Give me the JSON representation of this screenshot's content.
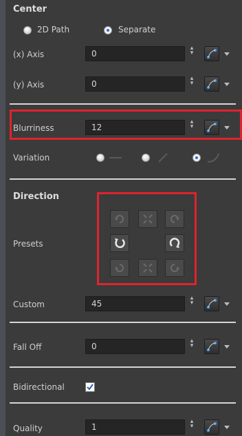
{
  "center": {
    "title": "Center",
    "path_option_1": "2D Path",
    "path_option_2": "Separate",
    "selected": "Separate",
    "x_axis": {
      "label": "(x) Axis",
      "value": "0"
    },
    "y_axis": {
      "label": "(y) Axis",
      "value": "0"
    }
  },
  "blurriness": {
    "label": "Blurriness",
    "value": "12"
  },
  "variation": {
    "label": "Variation",
    "selected_index": 2
  },
  "direction": {
    "title": "Direction",
    "presets_label": "Presets",
    "custom": {
      "label": "Custom",
      "value": "45"
    }
  },
  "fall_off": {
    "label": "Fall Off",
    "value": "0"
  },
  "bidirectional": {
    "label": "Bidirectional",
    "checked": true
  },
  "quality": {
    "label": "Quality",
    "value": "1"
  },
  "colors": {
    "highlight": "#e0232c",
    "accent": "#2b6ec8"
  },
  "icons": {
    "function_button": "function-curve-icon",
    "menu_arrow": "dropdown-arrow-icon",
    "spinner": "spinner-arrows-icon",
    "check": "checkmark-icon"
  }
}
